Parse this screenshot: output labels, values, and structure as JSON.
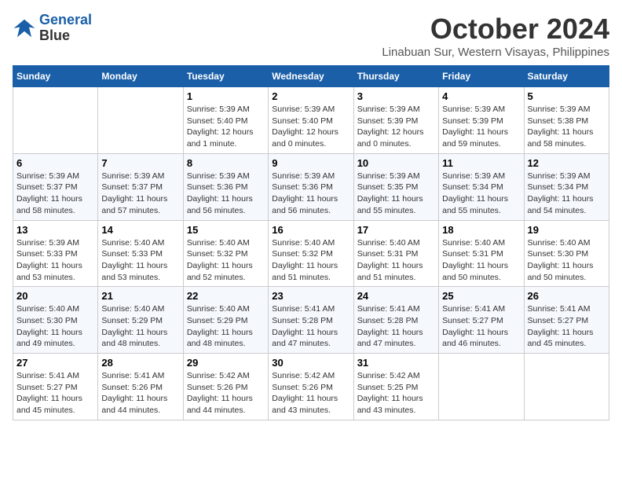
{
  "logo": {
    "line1": "General",
    "line2": "Blue"
  },
  "title": "October 2024",
  "location": "Linabuan Sur, Western Visayas, Philippines",
  "headers": [
    "Sunday",
    "Monday",
    "Tuesday",
    "Wednesday",
    "Thursday",
    "Friday",
    "Saturday"
  ],
  "weeks": [
    [
      {
        "day": "",
        "text": ""
      },
      {
        "day": "",
        "text": ""
      },
      {
        "day": "1",
        "text": "Sunrise: 5:39 AM\nSunset: 5:40 PM\nDaylight: 12 hours and 1 minute."
      },
      {
        "day": "2",
        "text": "Sunrise: 5:39 AM\nSunset: 5:40 PM\nDaylight: 12 hours and 0 minutes."
      },
      {
        "day": "3",
        "text": "Sunrise: 5:39 AM\nSunset: 5:39 PM\nDaylight: 12 hours and 0 minutes."
      },
      {
        "day": "4",
        "text": "Sunrise: 5:39 AM\nSunset: 5:39 PM\nDaylight: 11 hours and 59 minutes."
      },
      {
        "day": "5",
        "text": "Sunrise: 5:39 AM\nSunset: 5:38 PM\nDaylight: 11 hours and 58 minutes."
      }
    ],
    [
      {
        "day": "6",
        "text": "Sunrise: 5:39 AM\nSunset: 5:37 PM\nDaylight: 11 hours and 58 minutes."
      },
      {
        "day": "7",
        "text": "Sunrise: 5:39 AM\nSunset: 5:37 PM\nDaylight: 11 hours and 57 minutes."
      },
      {
        "day": "8",
        "text": "Sunrise: 5:39 AM\nSunset: 5:36 PM\nDaylight: 11 hours and 56 minutes."
      },
      {
        "day": "9",
        "text": "Sunrise: 5:39 AM\nSunset: 5:36 PM\nDaylight: 11 hours and 56 minutes."
      },
      {
        "day": "10",
        "text": "Sunrise: 5:39 AM\nSunset: 5:35 PM\nDaylight: 11 hours and 55 minutes."
      },
      {
        "day": "11",
        "text": "Sunrise: 5:39 AM\nSunset: 5:34 PM\nDaylight: 11 hours and 55 minutes."
      },
      {
        "day": "12",
        "text": "Sunrise: 5:39 AM\nSunset: 5:34 PM\nDaylight: 11 hours and 54 minutes."
      }
    ],
    [
      {
        "day": "13",
        "text": "Sunrise: 5:39 AM\nSunset: 5:33 PM\nDaylight: 11 hours and 53 minutes."
      },
      {
        "day": "14",
        "text": "Sunrise: 5:40 AM\nSunset: 5:33 PM\nDaylight: 11 hours and 53 minutes."
      },
      {
        "day": "15",
        "text": "Sunrise: 5:40 AM\nSunset: 5:32 PM\nDaylight: 11 hours and 52 minutes."
      },
      {
        "day": "16",
        "text": "Sunrise: 5:40 AM\nSunset: 5:32 PM\nDaylight: 11 hours and 51 minutes."
      },
      {
        "day": "17",
        "text": "Sunrise: 5:40 AM\nSunset: 5:31 PM\nDaylight: 11 hours and 51 minutes."
      },
      {
        "day": "18",
        "text": "Sunrise: 5:40 AM\nSunset: 5:31 PM\nDaylight: 11 hours and 50 minutes."
      },
      {
        "day": "19",
        "text": "Sunrise: 5:40 AM\nSunset: 5:30 PM\nDaylight: 11 hours and 50 minutes."
      }
    ],
    [
      {
        "day": "20",
        "text": "Sunrise: 5:40 AM\nSunset: 5:30 PM\nDaylight: 11 hours and 49 minutes."
      },
      {
        "day": "21",
        "text": "Sunrise: 5:40 AM\nSunset: 5:29 PM\nDaylight: 11 hours and 48 minutes."
      },
      {
        "day": "22",
        "text": "Sunrise: 5:40 AM\nSunset: 5:29 PM\nDaylight: 11 hours and 48 minutes."
      },
      {
        "day": "23",
        "text": "Sunrise: 5:41 AM\nSunset: 5:28 PM\nDaylight: 11 hours and 47 minutes."
      },
      {
        "day": "24",
        "text": "Sunrise: 5:41 AM\nSunset: 5:28 PM\nDaylight: 11 hours and 47 minutes."
      },
      {
        "day": "25",
        "text": "Sunrise: 5:41 AM\nSunset: 5:27 PM\nDaylight: 11 hours and 46 minutes."
      },
      {
        "day": "26",
        "text": "Sunrise: 5:41 AM\nSunset: 5:27 PM\nDaylight: 11 hours and 45 minutes."
      }
    ],
    [
      {
        "day": "27",
        "text": "Sunrise: 5:41 AM\nSunset: 5:27 PM\nDaylight: 11 hours and 45 minutes."
      },
      {
        "day": "28",
        "text": "Sunrise: 5:41 AM\nSunset: 5:26 PM\nDaylight: 11 hours and 44 minutes."
      },
      {
        "day": "29",
        "text": "Sunrise: 5:42 AM\nSunset: 5:26 PM\nDaylight: 11 hours and 44 minutes."
      },
      {
        "day": "30",
        "text": "Sunrise: 5:42 AM\nSunset: 5:26 PM\nDaylight: 11 hours and 43 minutes."
      },
      {
        "day": "31",
        "text": "Sunrise: 5:42 AM\nSunset: 5:25 PM\nDaylight: 11 hours and 43 minutes."
      },
      {
        "day": "",
        "text": ""
      },
      {
        "day": "",
        "text": ""
      }
    ]
  ]
}
